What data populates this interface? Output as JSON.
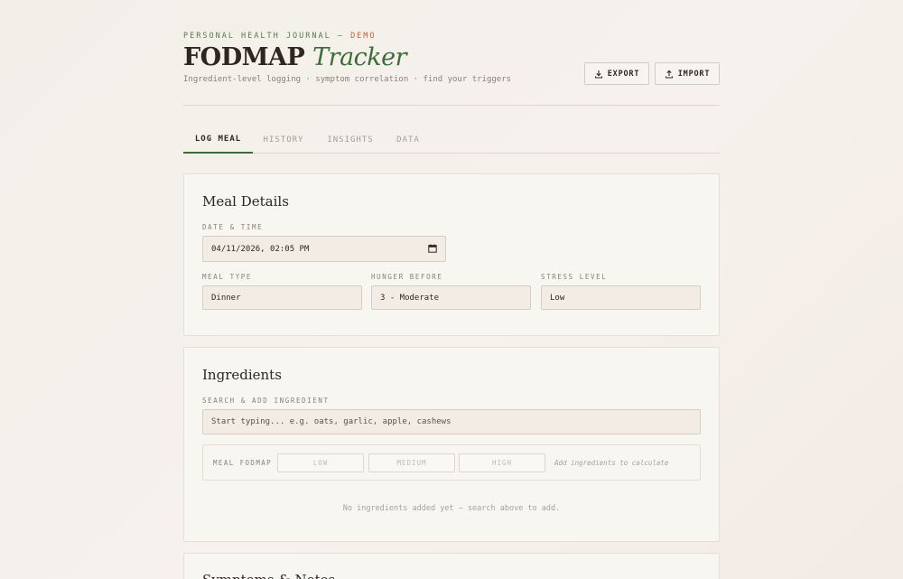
{
  "header": {
    "eyebrow": "PERSONAL HEALTH JOURNAL — ",
    "eyebrow_demo": "DEMO",
    "title_main": "FODMAP",
    "title_accent": "Tracker",
    "subtitle": "Ingredient-level logging · symptom correlation · find your triggers",
    "export_label": "EXPORT",
    "import_label": "IMPORT"
  },
  "tabs": [
    {
      "label": "LOG MEAL",
      "active": true
    },
    {
      "label": "HISTORY",
      "active": false
    },
    {
      "label": "INSIGHTS",
      "active": false
    },
    {
      "label": "DATA",
      "active": false
    }
  ],
  "meal_details": {
    "title": "Meal Details",
    "datetime_label": "DATE & TIME",
    "datetime_value": "04/11/2026, 02:05 PM",
    "meal_type_label": "MEAL TYPE",
    "meal_type_value": "Dinner",
    "hunger_label": "HUNGER BEFORE",
    "hunger_value": "3 - Moderate",
    "stress_label": "STRESS LEVEL",
    "stress_value": "Low"
  },
  "ingredients": {
    "title": "Ingredients",
    "search_label": "SEARCH & ADD INGREDIENT",
    "search_placeholder": "Start typing... e.g. oats, garlic, apple, cashews",
    "fodmap_label": "MEAL FODMAP",
    "levels": [
      "LOW",
      "MEDIUM",
      "HIGH"
    ],
    "calc_hint": "Add ingredients to calculate",
    "empty_text": "No ingredients added yet — search above to add."
  },
  "symptoms": {
    "title": "Symptoms & Notes"
  },
  "colors": {
    "accent_green": "#3f6b3a",
    "accent_orange": "#c0643a",
    "background": "#f4efe9"
  }
}
